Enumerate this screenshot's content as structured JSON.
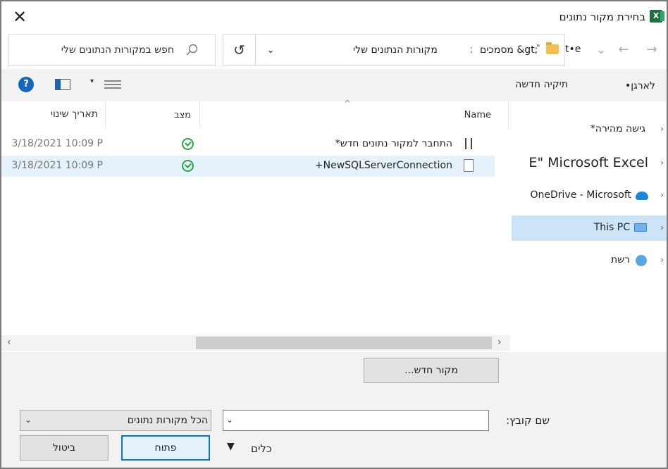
{
  "window": {
    "title": "בחירת מקור נתונים",
    "close_glyph": "✕"
  },
  "address": {
    "search_placeholder": "חפש במקורות הנתונים שלי",
    "crumbs": [
      "t•e",
      "מסמכים &gt;",
      "מקורות הנתונים שלי"
    ],
    "crumb_sep": ";",
    "crumb_quote": "\"",
    "refresh_glyph": "↺",
    "dropdown_glyph": "⌄",
    "nav_back": "←",
    "nav_forward": "→",
    "nav_recent": "⌄"
  },
  "toolbar": {
    "organize": "לארגן•",
    "new_folder": "תיקיה חדשה",
    "help": "?",
    "view_arrow": "▾"
  },
  "nav_pane": {
    "items": [
      {
        "label": "*גישה מהירה",
        "chevron": "›"
      },
      {
        "label": "E\" Microsoft Excel",
        "chevron": "›"
      },
      {
        "label": "OneDrive - Microsoft",
        "chevron": "›"
      },
      {
        "label": "This PC",
        "chevron": "›"
      },
      {
        "label": "רשת",
        "chevron": "›"
      }
    ]
  },
  "file_list": {
    "columns": {
      "name": "Name",
      "status": "מצב",
      "date": "תאריך שינוי"
    },
    "sort_glyph": "^",
    "rows": [
      {
        "name": "*התחבר למקור נתונים חדש",
        "date": "3/18/2021 10:09 P"
      },
      {
        "name": "+NewSQLServerConnection",
        "date": "3/18/2021 10:09 P"
      }
    ]
  },
  "scroll": {
    "left": "‹",
    "right": "›"
  },
  "bottom": {
    "new_source": "מקור חדש...",
    "filename_label": "שם קובץ:",
    "filename_value": "",
    "filename_chev": "⌄",
    "type_value": "הכל מקורות נתונים",
    "type_chev": "⌄",
    "tools": "כלים",
    "tools_arrow": "▼",
    "open": "פתוח",
    "cancel": "ביטול"
  },
  "colors": {
    "accent": "#0078d7",
    "selection": "#cce4f7",
    "excel_green": "#1d6f42",
    "status_green": "#2aa745"
  }
}
